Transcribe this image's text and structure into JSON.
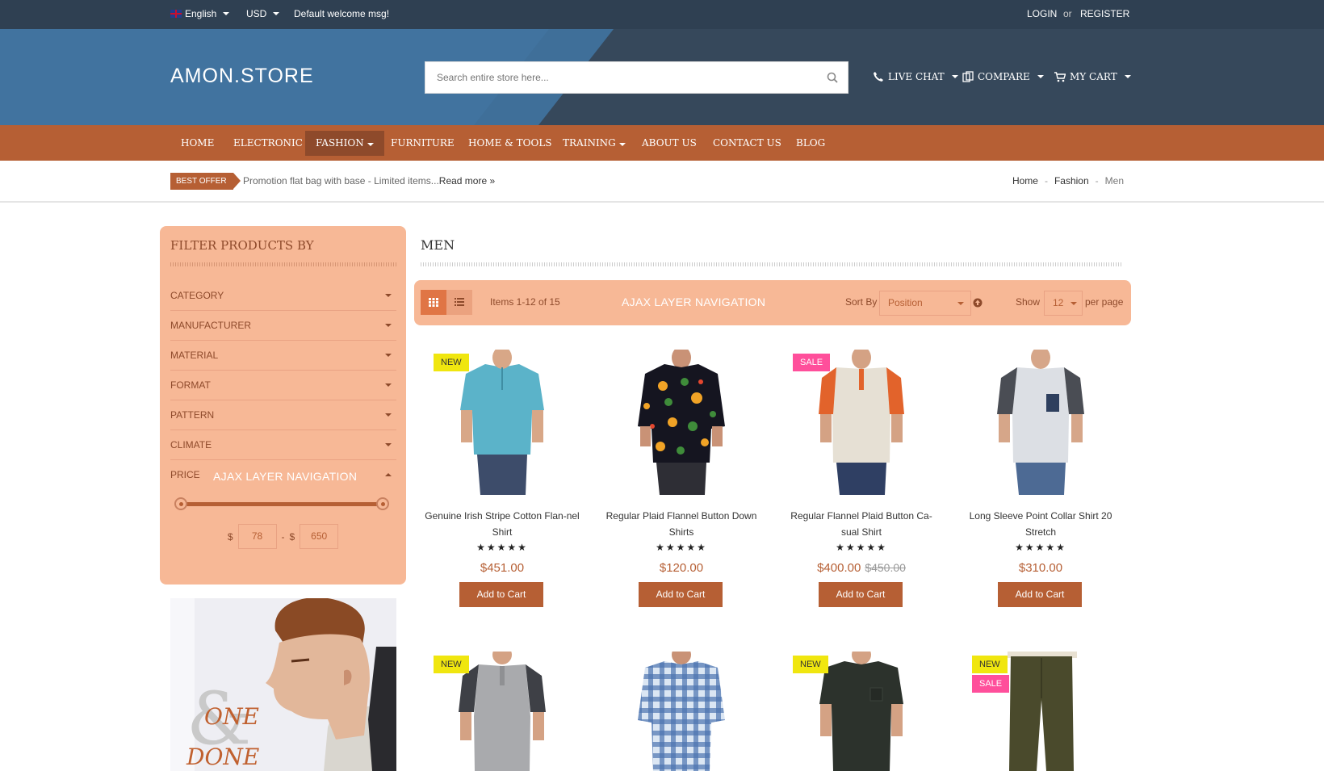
{
  "topbar": {
    "language": "English",
    "currency": "USD",
    "welcome": "Default welcome msg!",
    "login": "LOGIN",
    "or": "or",
    "register": "REGISTER"
  },
  "header": {
    "logo": "AMON.STORE",
    "search_placeholder": "Search entire store here...",
    "live_chat": "LIVE CHAT",
    "compare": "COMPARE",
    "my_cart": "MY CART"
  },
  "nav": {
    "items": [
      {
        "label": "HOME"
      },
      {
        "label": "ELECTRONIC"
      },
      {
        "label": "FASHION"
      },
      {
        "label": "FURNITURE"
      },
      {
        "label": "HOME & TOOLS"
      },
      {
        "label": "TRAINING"
      },
      {
        "label": "ABOUT US"
      },
      {
        "label": "CONTACT US"
      },
      {
        "label": "BLOG"
      }
    ]
  },
  "offer": {
    "badge": "BEST OFFER",
    "text": "Promotion flat bag with base - Limited items...",
    "read_more": "Read more »"
  },
  "breadcrumb": {
    "home": "Home",
    "sep": "-",
    "fashion": "Fashion",
    "current": "Men"
  },
  "sidebar": {
    "title": "FILTER PRODUCTS BY",
    "filters": [
      {
        "label": "CATEGORY"
      },
      {
        "label": "MANUFACTURER"
      },
      {
        "label": "MATERIAL"
      },
      {
        "label": "FORMAT"
      },
      {
        "label": "PATTERN"
      },
      {
        "label": "CLIMATE"
      },
      {
        "label": "PRICE"
      }
    ],
    "ajax_label": "AJAX LAYER NAVIGATION",
    "currency_symbol": "$",
    "price_min": "78",
    "price_sep": "-",
    "price_max": "650",
    "banner_text_1": "ONE",
    "banner_text_2": "DONE",
    "banner_amp": "&"
  },
  "main": {
    "title": "MEN",
    "items_count": "Items 1-12 of 15",
    "ajax_label": "AJAX LAYER NAVIGATION",
    "sort_by_label": "Sort By",
    "sort_value": "Position",
    "show_label": "Show",
    "show_value": "12",
    "per_page": "per page"
  },
  "products": [
    {
      "name": "Genuine Irish Stripe Cotton Flan-nel Shirt",
      "stars": "★★★★★",
      "price": "$451.00",
      "old_price": "",
      "tags": [
        "NEW"
      ],
      "add": "Add to Cart"
    },
    {
      "name": "Regular Plaid Flannel Button Down Shirts",
      "stars": "★★★★★",
      "price": "$120.00",
      "old_price": "",
      "tags": [],
      "add": "Add to Cart"
    },
    {
      "name": "Regular Flannel Plaid Button Ca-sual Shirt",
      "stars": "★★★★★",
      "price": "$400.00",
      "old_price": "$450.00",
      "tags": [
        "SALE"
      ],
      "add": "Add to Cart"
    },
    {
      "name": "Long Sleeve Point Collar Shirt 20 Stretch",
      "stars": "★★★★★",
      "price": "$310.00",
      "old_price": "",
      "tags": [],
      "add": "Add to Cart"
    },
    {
      "tags": [
        "NEW"
      ]
    },
    {
      "tags": []
    },
    {
      "tags": [
        "NEW"
      ]
    },
    {
      "tags": [
        "NEW",
        "SALE"
      ]
    }
  ],
  "colors": {
    "accent": "#b65f34",
    "peach": "#f7b896",
    "dark": "#2f4052"
  }
}
